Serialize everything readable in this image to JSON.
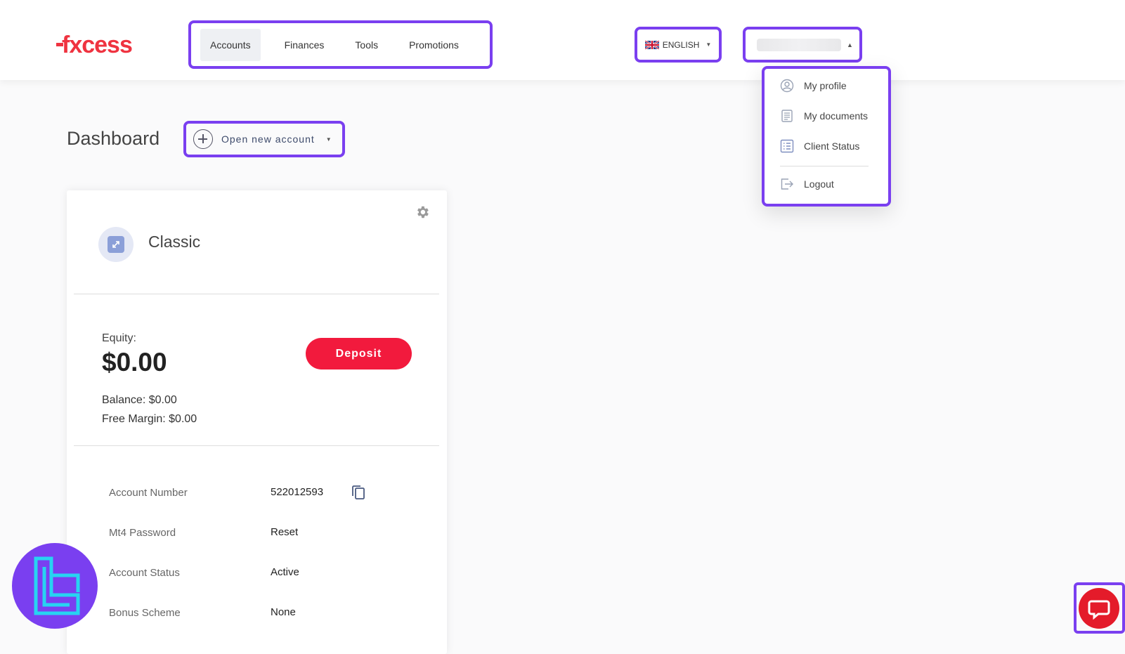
{
  "header": {
    "logo": "FXCESS",
    "nav": [
      "Accounts",
      "Finances",
      "Tools",
      "Promotions"
    ],
    "active_nav": "Accounts",
    "language": "ENGLISH"
  },
  "user_menu": {
    "items": [
      {
        "label": "My profile",
        "icon": "user-circle-icon"
      },
      {
        "label": "My documents",
        "icon": "document-icon"
      },
      {
        "label": "Client Status",
        "icon": "list-icon"
      },
      {
        "label": "Logout",
        "icon": "logout-icon"
      }
    ]
  },
  "page": {
    "title": "Dashboard",
    "open_account_label": "Open new account"
  },
  "account_card": {
    "type": "Classic",
    "equity_label": "Equity:",
    "equity_value": "$0.00",
    "deposit_label": "Deposit",
    "balance_label": "Balance:",
    "balance_value": "$0.00",
    "free_margin_label": "Free Margin:",
    "free_margin_value": "$0.00",
    "details": [
      {
        "label": "Account Number",
        "value": "522012593"
      },
      {
        "label": "Mt4 Password",
        "value": "Reset"
      },
      {
        "label": "Account Status",
        "value": "Active"
      },
      {
        "label": "Bonus Scheme",
        "value": "None"
      }
    ]
  },
  "colors": {
    "brand_red": "#f21a3d",
    "highlight": "#7a3ff0",
    "chat_red": "#e41b2a"
  }
}
